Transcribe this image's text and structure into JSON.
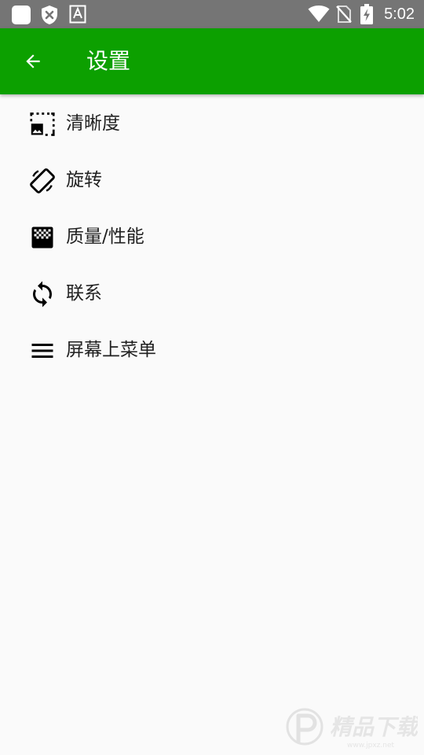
{
  "status_bar": {
    "time": "5:02",
    "left_icons": [
      "app-notification-icon",
      "shield-icon",
      "font-a-icon"
    ],
    "right_icons": [
      "wifi-icon",
      "no-sim-icon",
      "battery-charging-icon"
    ],
    "background": "#757575"
  },
  "app_bar": {
    "title": "设置",
    "back_icon": "arrow-back-icon",
    "background": "#0ca000"
  },
  "settings": {
    "items": [
      {
        "label": "清晰度",
        "icon": "image-resolution-icon"
      },
      {
        "label": "旋转",
        "icon": "screen-rotation-icon"
      },
      {
        "label": "质量/性能",
        "icon": "gradient-quality-icon"
      },
      {
        "label": "联系",
        "icon": "sync-icon"
      },
      {
        "label": "屏幕上菜单",
        "icon": "menu-icon"
      }
    ]
  },
  "watermark": {
    "text": "精品下载",
    "subtext": "www.jpxz.net"
  }
}
